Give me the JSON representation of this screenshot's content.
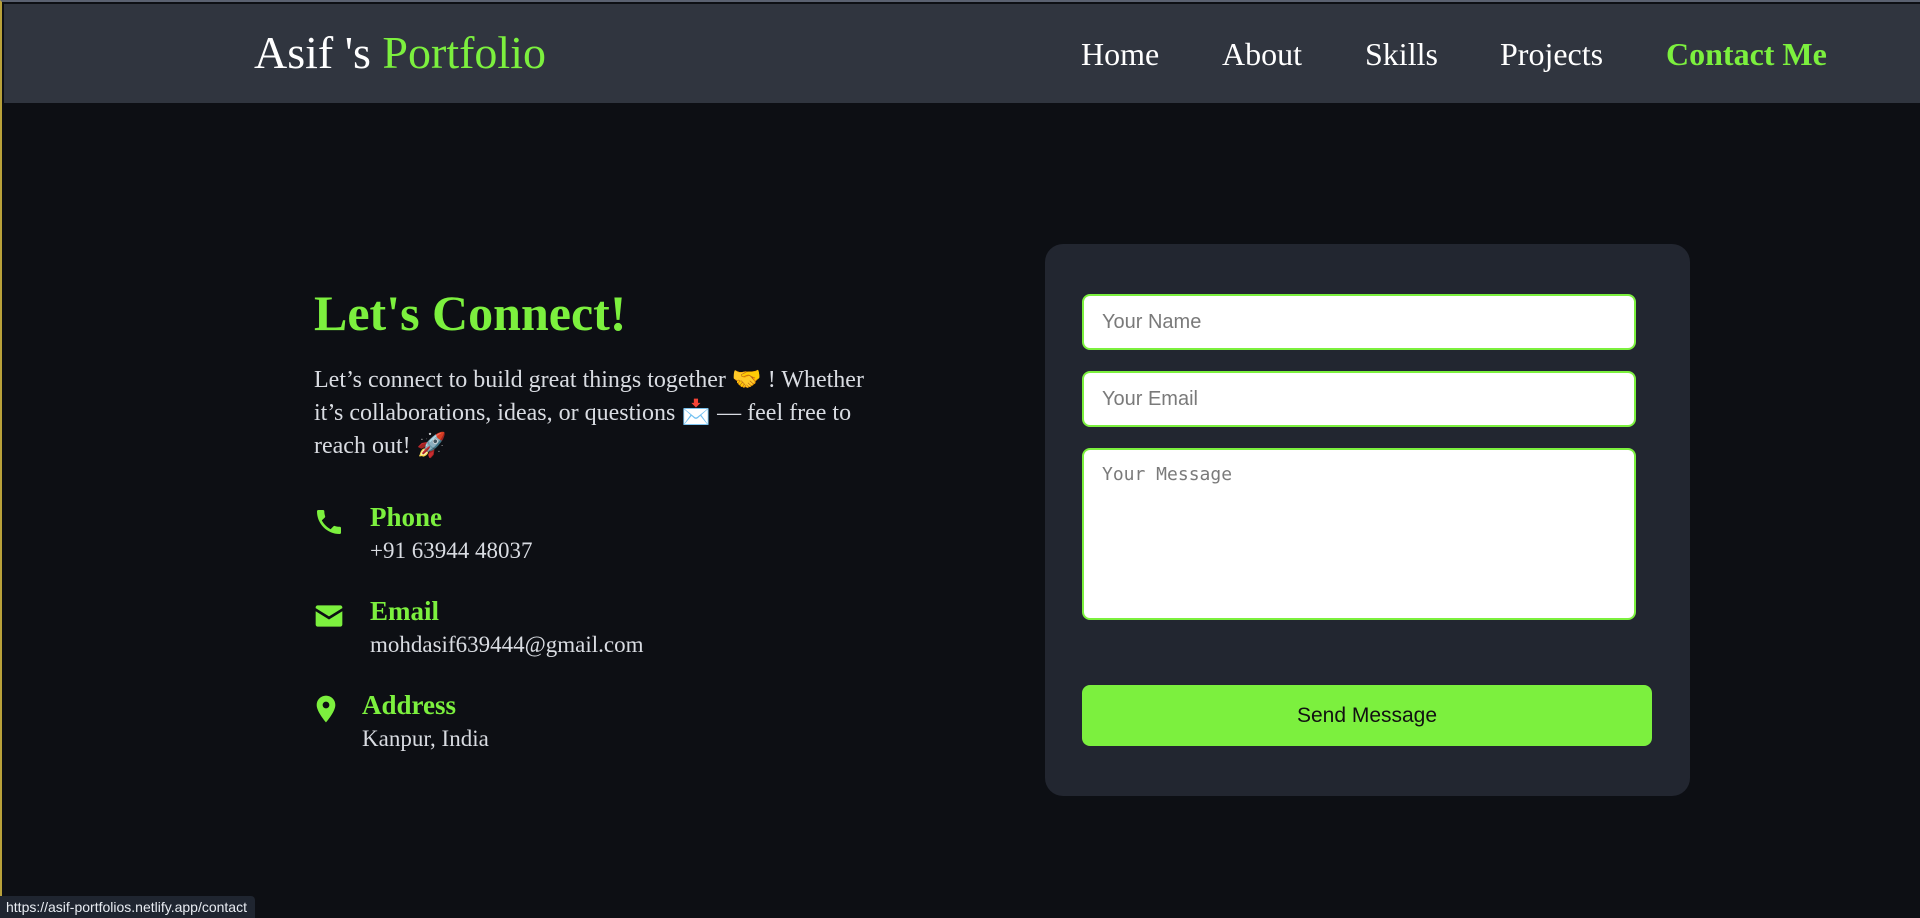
{
  "header": {
    "logo_name": "Asif 's",
    "logo_accent": "Portfolio",
    "nav": [
      {
        "label": "Home"
      },
      {
        "label": "About"
      },
      {
        "label": "Skills"
      },
      {
        "label": "Projects"
      },
      {
        "label": "Contact Me",
        "active": true
      }
    ]
  },
  "connect": {
    "title": "Let's Connect!",
    "text": "Let’s connect to build great things together 🤝 ! Whether it’s collaborations, ideas, or questions 📩 — feel free to reach out! 🚀"
  },
  "contacts": [
    {
      "icon": "phone-icon",
      "label": "Phone",
      "value": "+91 63944 48037"
    },
    {
      "icon": "envelope-icon",
      "label": "Email",
      "value": "mohdasif639444@gmail.com"
    },
    {
      "icon": "map-pin-icon",
      "label": "Address",
      "value": "Kanpur, India"
    }
  ],
  "form": {
    "name_placeholder": "Your Name",
    "email_placeholder": "Your Email",
    "message_placeholder": "Your Message",
    "submit_label": "Send Message"
  },
  "status_url": "https://asif-portfolios.netlify.app/contact",
  "colors": {
    "accent": "#7cf03e",
    "header_bg": "#30353f",
    "page_bg": "#0d0f14",
    "card_bg": "#222630"
  }
}
